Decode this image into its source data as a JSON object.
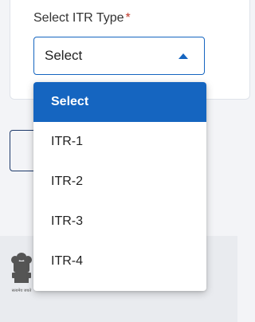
{
  "form": {
    "label": "Select ITR Type",
    "required_mark": "*",
    "selected_value": "Select"
  },
  "dropdown": {
    "options": [
      {
        "label": "Select",
        "selected": true
      },
      {
        "label": "ITR-1",
        "selected": false
      },
      {
        "label": "ITR-2",
        "selected": false
      },
      {
        "label": "ITR-3",
        "selected": false
      },
      {
        "label": "ITR-4",
        "selected": false
      }
    ]
  },
  "footer": {
    "emblem_text": "सत्यमेव जयते"
  },
  "colors": {
    "accent": "#1565c0",
    "required": "#c0392b",
    "page_bg": "#f3f4f7"
  }
}
